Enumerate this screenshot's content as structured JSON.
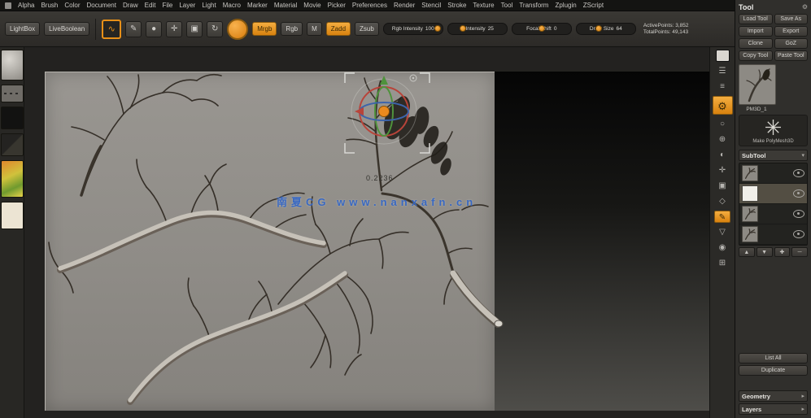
{
  "menu": {
    "items": [
      "Alpha",
      "Brush",
      "Color",
      "Document",
      "Draw",
      "Edit",
      "File",
      "Layer",
      "Light",
      "Macro",
      "Marker",
      "Material",
      "Movie",
      "Picker",
      "Preferences",
      "Render",
      "Stencil",
      "Stroke",
      "Texture",
      "Tool",
      "Transform",
      "Zplugin",
      "ZScript"
    ]
  },
  "toolbar": {
    "lightbox_label": "LightBox",
    "liveboolean_label": "LiveBoolean",
    "sculptris_icon": "∿",
    "icon_buttons": [
      {
        "name": "edit-mode-button",
        "glyph": "✎"
      },
      {
        "name": "draw-mode-button",
        "glyph": "●"
      },
      {
        "name": "move-mode-button",
        "glyph": "✛"
      },
      {
        "name": "scale-mode-button",
        "glyph": "▣"
      },
      {
        "name": "rotate-mode-button",
        "glyph": "↻"
      }
    ],
    "paint_modes": [
      {
        "label": "Mrgb",
        "active": true
      },
      {
        "label": "Rgb",
        "active": false
      },
      {
        "label": "M",
        "active": false
      }
    ],
    "sculpt_modes": [
      {
        "label": "Zadd",
        "active": true
      },
      {
        "label": "Zsub",
        "active": false
      }
    ],
    "sliders": [
      {
        "label": "Rgb Intensity",
        "value": 100,
        "pct": 92
      },
      {
        "label": "Z Intensity",
        "value": 25,
        "pct": 25
      },
      {
        "label": "Focal Shift",
        "value": 0,
        "pct": 50
      },
      {
        "label": "Draw Size",
        "value": 64,
        "pct": 38
      }
    ],
    "info_lines": [
      {
        "label": "ActivePoints:",
        "value": "3,852"
      },
      {
        "label": "TotalPoints:",
        "value": "49,143"
      }
    ]
  },
  "left_shelf": {
    "items": [
      {
        "name": "current-brush-thumbnail",
        "kind": "brush"
      },
      {
        "name": "stroke-thumbnail",
        "kind": "stroke"
      },
      {
        "name": "alpha-thumbnail",
        "kind": "alpha"
      },
      {
        "name": "texture-thumbnail",
        "kind": "texture"
      },
      {
        "name": "material-thumbnail",
        "kind": "material"
      },
      {
        "name": "color-swatch",
        "kind": "swatch"
      }
    ]
  },
  "canvas": {
    "gizmo_value": "0.2236",
    "watermark": "南夏CG www.nanxafn.cn",
    "accent_colors": {
      "gizmo_center": "#ea8a1e",
      "axis_x": "#b8443a",
      "axis_y": "#4f923c",
      "axis_z": "#3d64aa",
      "watermark_blue": "#2f63c4"
    }
  },
  "right_shelf": {
    "icons": [
      {
        "name": "document-thumbnail",
        "glyph": "",
        "thumb": true
      },
      {
        "name": "scroll-document-icon",
        "glyph": "☰"
      },
      {
        "name": "zoom-document-icon",
        "glyph": "≡"
      },
      {
        "name": "render-settings-icon",
        "glyph": "⚙",
        "big": true,
        "active": true
      },
      {
        "name": "persp-icon",
        "glyph": "○"
      },
      {
        "name": "floor-icon",
        "glyph": "⊕"
      },
      {
        "name": "local-symmetry-icon",
        "glyph": "◐"
      },
      {
        "name": "transp-icon",
        "glyph": "✛"
      },
      {
        "name": "solo-icon",
        "glyph": "▣"
      },
      {
        "name": "frame-icon",
        "glyph": "◇"
      },
      {
        "name": "polyframe-icon",
        "glyph": "✎",
        "active": true
      },
      {
        "name": "scroll-icon",
        "glyph": "▽"
      },
      {
        "name": "zoom-icon",
        "glyph": "◉"
      },
      {
        "name": "actual-size-icon",
        "glyph": "⊞"
      }
    ]
  },
  "tool_panel": {
    "title": "Tool",
    "buttons": [
      "Load Tool",
      "Save As",
      "Import",
      "Export",
      "Clone",
      "GoZ",
      "Copy Tool",
      "Paste Tool"
    ],
    "current_tool_name": "PM3D_1",
    "make_polymesh_star": "✳",
    "make_polymesh_label": "Make PolyMesh3D",
    "subtool_header": "SubTool",
    "subtools": [
      {
        "type": "branch",
        "selected": false
      },
      {
        "type": "white",
        "selected": true
      },
      {
        "type": "branch",
        "selected": false
      },
      {
        "type": "branch",
        "selected": false
      }
    ],
    "subtool_actions": [
      {
        "name": "subtool-up-button",
        "glyph": "▲"
      },
      {
        "name": "subtool-down-button",
        "glyph": "▼"
      },
      {
        "name": "subtool-append-button",
        "glyph": "✚"
      },
      {
        "name": "subtool-delete-button",
        "glyph": "─"
      }
    ],
    "wide_buttons": [
      "List All",
      "Duplicate"
    ],
    "section_headers": [
      "Geometry",
      "Layers"
    ]
  }
}
